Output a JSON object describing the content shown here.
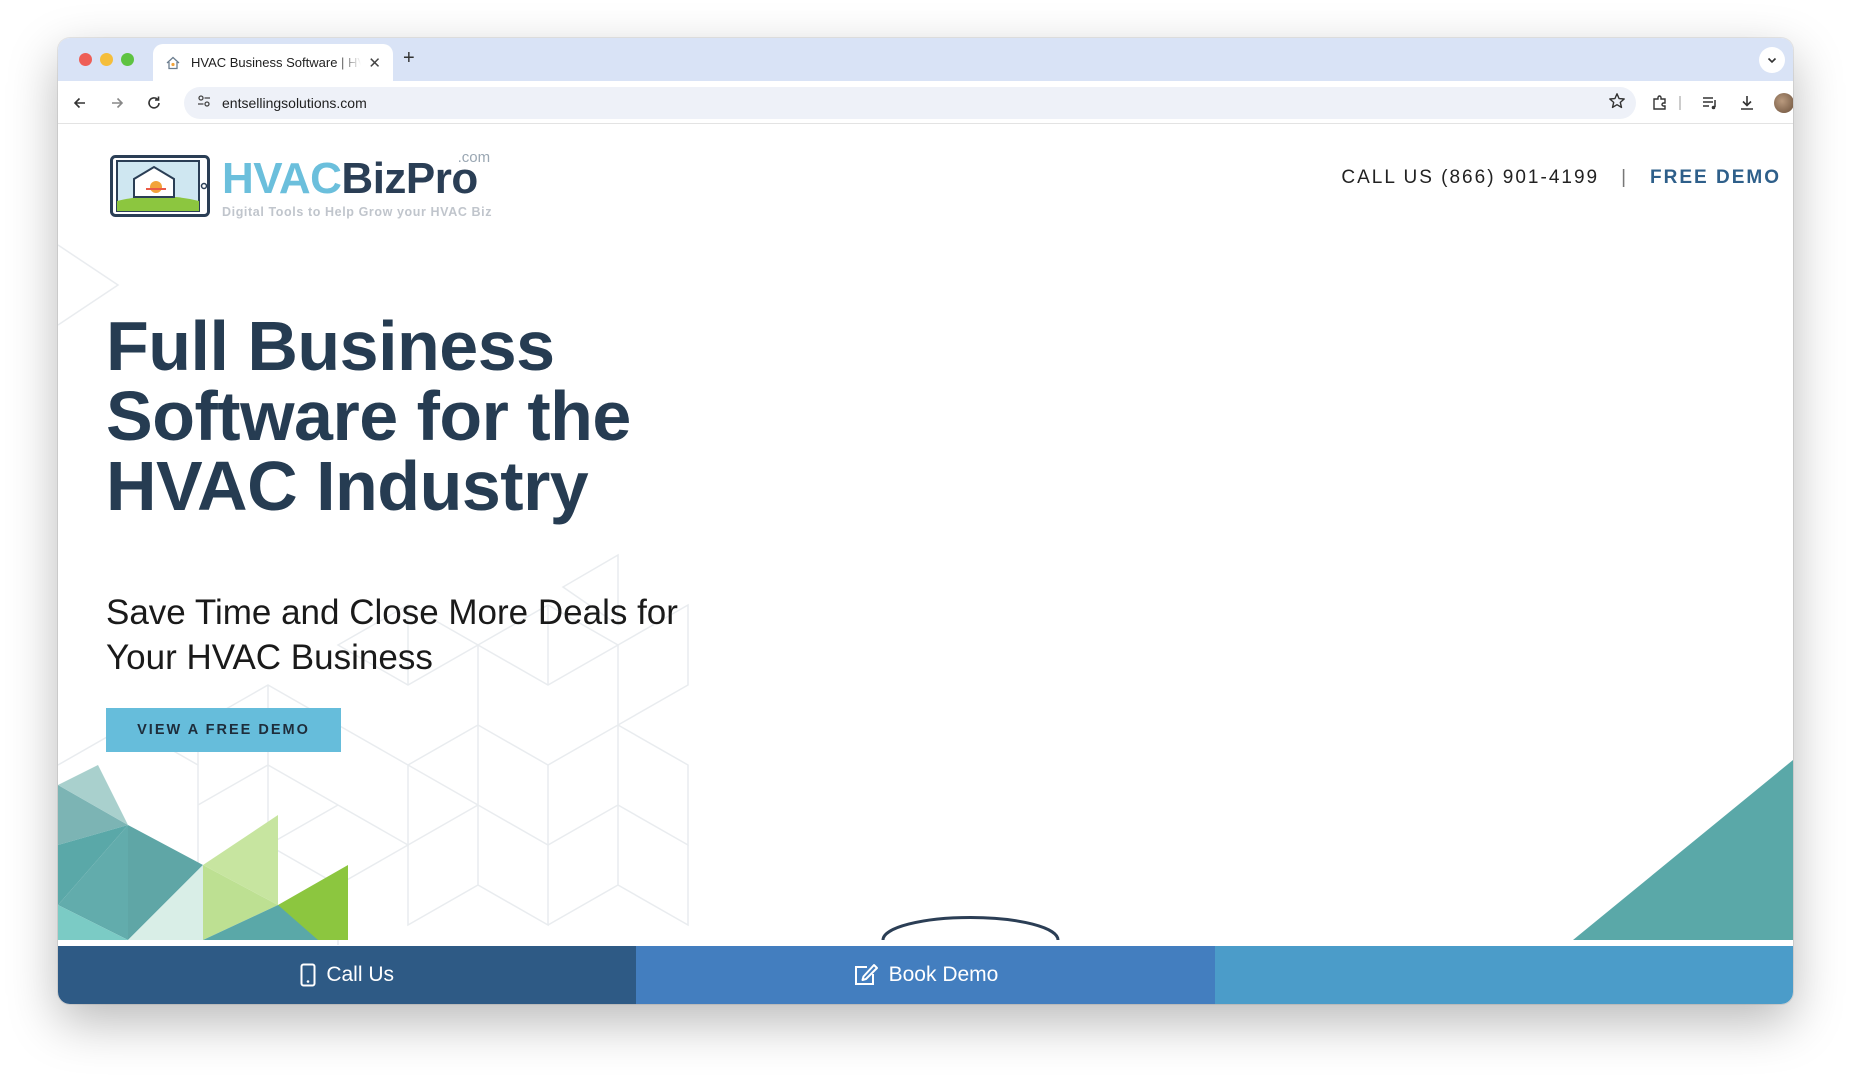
{
  "browser": {
    "tab_title": "HVAC Business Software | HVAC",
    "url": "entsellingsolutions.com",
    "new_tab_label": "+"
  },
  "site": {
    "logo": {
      "hvac": "HVAC",
      "bizpro": "BizPro",
      "com": ".com",
      "tagline": "Digital Tools to Help Grow your HVAC Biz"
    },
    "header": {
      "call": "CALL US (866) 901-4199",
      "divider": "|",
      "free_demo": "FREE DEMO"
    },
    "hero": {
      "title": "Full Business Software for the HVAC Industry",
      "subtitle": "Save Time and Close More Deals for Your HVAC Business",
      "cta": "VIEW A FREE DEMO"
    },
    "bottom_bar": {
      "call_us": "Call Us",
      "book_demo": "Book Demo"
    }
  },
  "colors": {
    "brand_dark": "#263c52",
    "brand_light": "#6bbfdc",
    "teal": "#5aa8a8",
    "green": "#8cc63f"
  }
}
